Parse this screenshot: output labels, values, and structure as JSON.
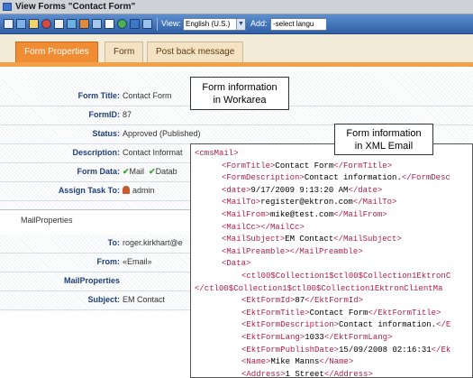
{
  "window": {
    "title": "View Forms \"Contact Form\""
  },
  "toolbar": {
    "view_label": "View:",
    "language_value": "English (U.S.)",
    "add_label": "Add:",
    "add_value": "-select langu"
  },
  "tabs": [
    {
      "label": "Form Properties"
    },
    {
      "label": "Form"
    },
    {
      "label": "Post back message"
    }
  ],
  "form": {
    "rows": [
      {
        "label": "Form Title:",
        "value": "Contact Form"
      },
      {
        "label": "FormID:",
        "value": "87"
      },
      {
        "label": "Status:",
        "value": "Approved (Published)"
      },
      {
        "label": "Description:",
        "value": "Contact Informat"
      },
      {
        "label": "Form Data:",
        "mail": "Mail",
        "database": "Datab"
      },
      {
        "label": "Assign Task To:",
        "value": "admin"
      }
    ],
    "section_title": "MailProperties",
    "mail_rows": [
      {
        "label": "To:",
        "value": "roger.kirkhart@e"
      },
      {
        "label": "From:",
        "value": "«Email»"
      },
      {
        "label": "MailProperties",
        "value": ""
      },
      {
        "label": "Subject:",
        "value": "EM Contact"
      }
    ]
  },
  "callouts": {
    "workarea_line1": "Form information",
    "workarea_line2": "in Workarea",
    "xml_line1": "Form information",
    "xml_line2": "in XML Email"
  },
  "xml_lines": [
    {
      "open": "<cmsMail>",
      "text": "",
      "close": ""
    },
    {
      "open": "<FormTitle>",
      "text": "Contact Form",
      "close": "</FormTitle>"
    },
    {
      "open": "<FormDescription>",
      "text": "Contact information.",
      "close": "</FormDesc"
    },
    {
      "open": "<date>",
      "text": "9/17/2009 9:13:20 AM",
      "close": "</date>"
    },
    {
      "open": "<MailTo>",
      "text": "register@ektron.com",
      "close": "</MailTo>"
    },
    {
      "open": "<MailFrom>",
      "text": "mike@test.com",
      "close": "</MailFrom>"
    },
    {
      "open": "<MailCc>",
      "text": "",
      "close": "</MailCc>"
    },
    {
      "open": "<MailSubject>",
      "text": "EM Contact",
      "close": "</MailSubject>"
    },
    {
      "open": "<MailPreamble>",
      "text": "",
      "close": "</MailPreamble>"
    },
    {
      "open": "<Data>",
      "text": "",
      "close": ""
    },
    {
      "open": "<ctl00$Collection1$ctl00$Collection1EktronC",
      "text": "",
      "close": ""
    },
    {
      "open": "</ctl00$Collection1$ctl00$Collection1EktronClientMa",
      "text": "",
      "close": ""
    },
    {
      "open": "<EktFormId>",
      "text": "87",
      "close": "</EktFormId>"
    },
    {
      "open": "<EktFormTitle>",
      "text": "Contact Form",
      "close": "</EktFormTitle>"
    },
    {
      "open": "<EktFormDescription>",
      "text": "Contact information.",
      "close": "</E"
    },
    {
      "open": "<EktFormLang>",
      "text": "1033",
      "close": "</EktFormLang>"
    },
    {
      "open": "<EktFormPublishDate>",
      "text": "15/09/2008 02:16:31",
      "close": "</Ek"
    },
    {
      "open": "<Name>",
      "text": "Mike Manns",
      "close": "</Name>"
    },
    {
      "open": "<Address>",
      "text": "1 Street",
      "close": "</Address>"
    }
  ]
}
